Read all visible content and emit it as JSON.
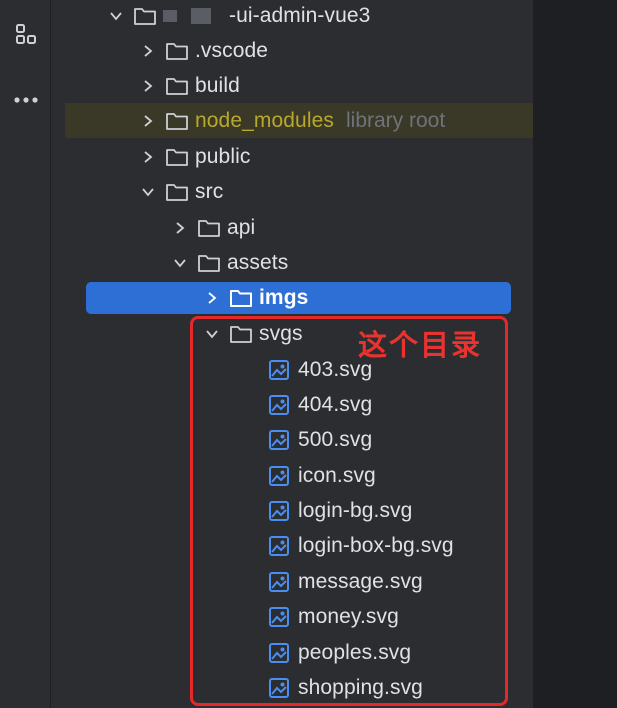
{
  "toolstrip": {
    "icons": [
      "structure-icon",
      "more-icon"
    ]
  },
  "tree": {
    "root": {
      "name": "-ui-admin-vue3",
      "expanded": true
    },
    "items": [
      {
        "label": ".vscode",
        "expanded": false
      },
      {
        "label": "build",
        "expanded": false
      },
      {
        "label": "node_modules",
        "hint": "library root",
        "expanded": false
      },
      {
        "label": "public",
        "expanded": false
      },
      {
        "label": "src",
        "expanded": true
      },
      {
        "label": "api",
        "expanded": false
      },
      {
        "label": "assets",
        "expanded": true
      },
      {
        "label": "imgs",
        "expanded": false,
        "selected": true
      },
      {
        "label": "svgs",
        "expanded": true
      }
    ],
    "svg_files": [
      "403.svg",
      "404.svg",
      "500.svg",
      "icon.svg",
      "login-bg.svg",
      "login-box-bg.svg",
      "message.svg",
      "money.svg",
      "peoples.svg",
      "shopping.svg"
    ]
  },
  "annotation": {
    "text": "这个目录",
    "color": "#e5282a"
  },
  "colors": {
    "background": "#2b2d30",
    "selection": "#2e6fd6",
    "library_text": "#b8a92d",
    "file_icon": "#4a8ff0"
  }
}
